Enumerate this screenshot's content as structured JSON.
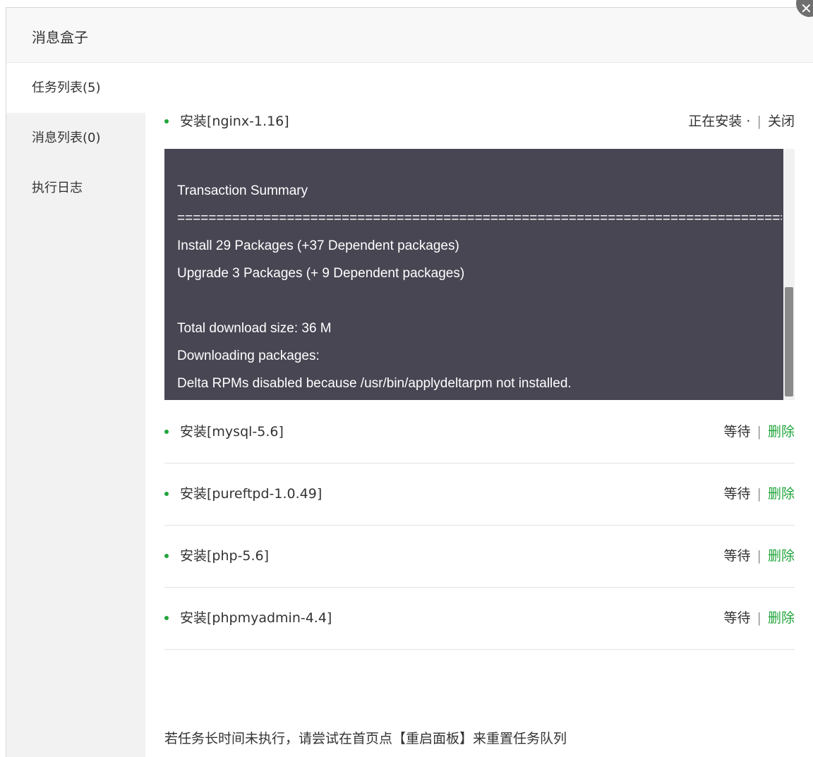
{
  "dialog": {
    "title": "消息盒子",
    "close_label": "✕"
  },
  "sidebar": {
    "items": [
      {
        "label": "任务列表(5)"
      },
      {
        "label": "消息列表(0)"
      },
      {
        "label": "执行日志"
      }
    ]
  },
  "current_task": {
    "name": "安装[nginx-1.16]",
    "status": "正在安装 ·",
    "separator": "|",
    "close_label": "关闭"
  },
  "console": {
    "lines": [
      "Transaction Summary",
      "=====================================================================================================",
      "Install 29 Packages (+37 Dependent packages)",
      "Upgrade 3 Packages (+ 9 Dependent packages)",
      "",
      "Total download size: 36 M",
      "Downloading packages:",
      "Delta RPMs disabled because /usr/bin/applydeltarpm not installed."
    ]
  },
  "tasks": [
    {
      "name": "安装[mysql-5.6]",
      "status": "等待",
      "separator": "|",
      "action": "删除"
    },
    {
      "name": "安装[pureftpd-1.0.49]",
      "status": "等待",
      "separator": "|",
      "action": "删除"
    },
    {
      "name": "安装[php-5.6]",
      "status": "等待",
      "separator": "|",
      "action": "删除"
    },
    {
      "name": "安装[phpmyadmin-4.4]",
      "status": "等待",
      "separator": "|",
      "action": "删除"
    }
  ],
  "footer": {
    "note": "若任务长时间未执行，请尝试在首页点【重启面板】来重置任务队列"
  },
  "colors": {
    "accent_green": "#20a53a",
    "console_bg": "#484653",
    "sidebar_bg": "#f2f2f2"
  }
}
